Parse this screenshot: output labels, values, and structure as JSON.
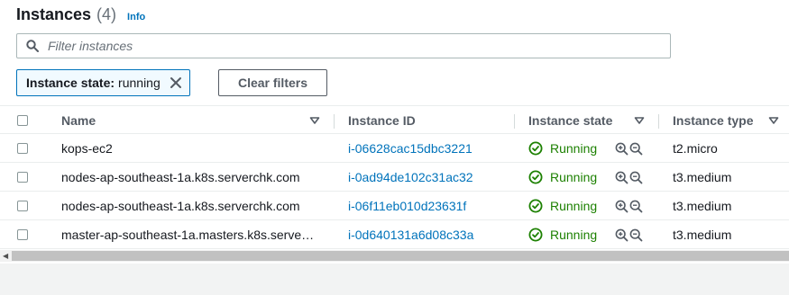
{
  "header": {
    "title": "Instances",
    "count": "(4)",
    "info_label": "Info"
  },
  "search": {
    "placeholder": "Filter instances",
    "value": ""
  },
  "filter_token": {
    "key": "Instance state:",
    "value": "running"
  },
  "clear_filters_label": "Clear filters",
  "columns": {
    "name": "Name",
    "instance_id": "Instance ID",
    "instance_state": "Instance state",
    "instance_type": "Instance type"
  },
  "rows": [
    {
      "name": "kops-ec2",
      "instance_id": "i-06628cac15dbc3221",
      "state": "Running",
      "type": "t2.micro"
    },
    {
      "name": "nodes-ap-southeast-1a.k8s.serverchk.com",
      "instance_id": "i-0ad94de102c31ac32",
      "state": "Running",
      "type": "t3.medium"
    },
    {
      "name": "nodes-ap-southeast-1a.k8s.serverchk.com",
      "instance_id": "i-06f11eb010d23631f",
      "state": "Running",
      "type": "t3.medium"
    },
    {
      "name": "master-ap-southeast-1a.masters.k8s.serve…",
      "instance_id": "i-0d640131a6d08c33a",
      "state": "Running",
      "type": "t3.medium"
    }
  ],
  "colors": {
    "link": "#0073bb",
    "running": "#1d8102",
    "text": "#16191f",
    "muted": "#545b64"
  },
  "icons": [
    "search-icon",
    "close-icon",
    "sort-caret-icon",
    "check-circle-icon",
    "zoom-in-icon",
    "zoom-out-icon",
    "scroll-left-arrow-icon"
  ]
}
